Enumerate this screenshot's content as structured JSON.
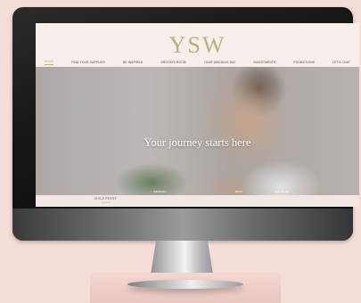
{
  "topbar": {
    "left": "— —",
    "right": "— —"
  },
  "logo": "YSW",
  "nav": [
    "HOME",
    "FIND YOUR SUPPLIER",
    "BE INSPIRED",
    "GROOM'S ROOM",
    "YOUR WEDDING DAY",
    "INVESTMENTS",
    "PROMOTIONS",
    "LET'S CHAT"
  ],
  "hero": {
    "title": "Your journey starts here",
    "bottom_left": "WEDDING",
    "bottom_mid": "BLOG",
    "bottom_right": "SEE MORE"
  },
  "brand": {
    "name": "ISALE PENNY",
    "sub": "BRIDAL"
  }
}
